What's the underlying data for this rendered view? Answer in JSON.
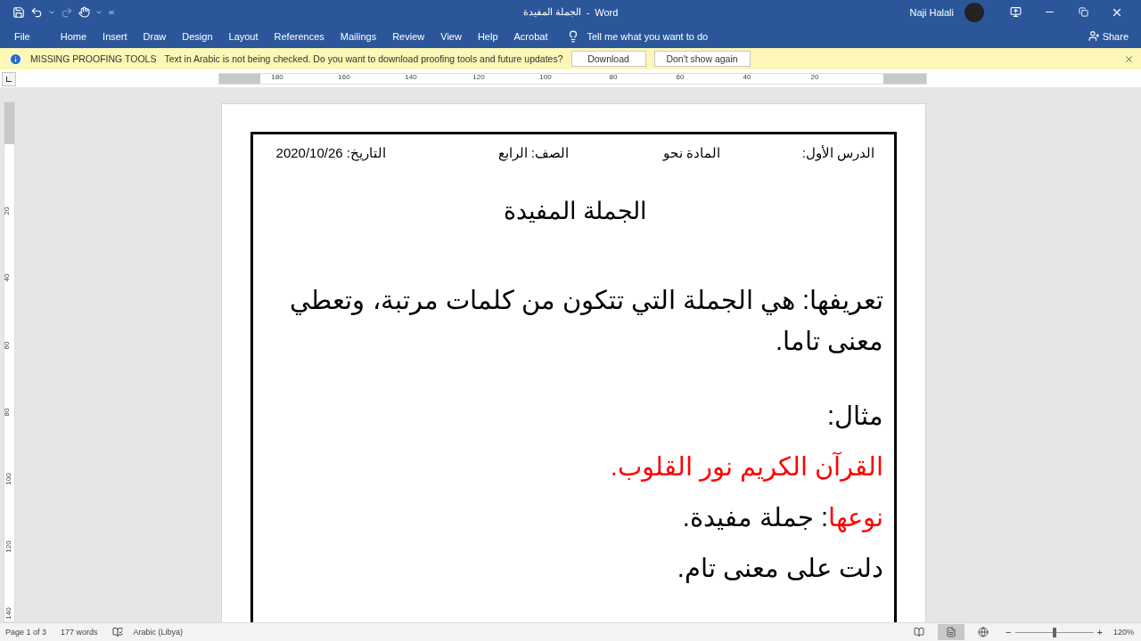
{
  "title_bar": {
    "quick_access": [
      {
        "kind": "save",
        "disabled": false
      },
      {
        "kind": "undo",
        "disabled": false
      },
      {
        "kind": "caret",
        "disabled": false
      },
      {
        "kind": "redo",
        "disabled": true
      },
      {
        "kind": "touch",
        "disabled": false
      },
      {
        "kind": "caret",
        "disabled": false
      },
      {
        "kind": "customize",
        "disabled": false
      }
    ],
    "document_title": "الجملة المفيدة",
    "separator": "-",
    "app": "Word",
    "user": "Naji Halali"
  },
  "ribbon_tabs": [
    "File",
    "Home",
    "Insert",
    "Draw",
    "Design",
    "Layout",
    "References",
    "Mailings",
    "Review",
    "View",
    "Help",
    "Acrobat"
  ],
  "tell_me": {
    "placeholder": "Tell me what you want to do"
  },
  "share": "Share",
  "message_bar": {
    "title": "MISSING PROOFING TOOLS",
    "text": "Text in Arabic is not being checked. Do you want to download proofing tools and future updates?",
    "buttons": [
      "Download",
      "Don't show again"
    ]
  },
  "horizontal_ruler": [
    "180",
    "160",
    "140",
    "120",
    "100",
    "80",
    "60",
    "40",
    "20"
  ],
  "vertical_ruler": [
    "20",
    "40",
    "60",
    "80",
    "100",
    "120",
    "140"
  ],
  "document": {
    "header": [
      "الدرس الأول:",
      "المادة نحو",
      "الصف: الرابع",
      "التاريخ: 2020/10/26"
    ],
    "heading": "الجملة المفيدة",
    "sections": [
      {
        "paragraphs": [
          {
            "segments": [
              {
                "text": "تعريفها: هي الجملة التي تتكون من كلمات مرتبة، وتعطي معنى تاما."
              }
            ]
          }
        ]
      },
      {
        "paragraphs": [
          {
            "segments": [
              {
                "text": "مثال:"
              }
            ]
          },
          {
            "segments": [
              {
                "text": "القرآن الكريم نور القلوب.",
                "color": "#ff0000"
              }
            ]
          },
          {
            "segments": [
              {
                "text": "نوعها",
                "color": "#ff0000"
              },
              {
                "text": ": جملة مفيدة."
              }
            ]
          },
          {
            "segments": [
              {
                "text": "دلت على معنى تام."
              }
            ]
          }
        ]
      }
    ]
  },
  "status_bar": {
    "page": "Page 1 of 3",
    "words": "177 words",
    "language": "Arabic (Libya)",
    "views": [
      {
        "kind": "read",
        "selected": false
      },
      {
        "kind": "print",
        "selected": true
      },
      {
        "kind": "web",
        "selected": false
      }
    ],
    "zoom_out": "−",
    "zoom_in": "+",
    "zoom": {
      "level": 0.5
    },
    "zoom_text": "120%"
  }
}
